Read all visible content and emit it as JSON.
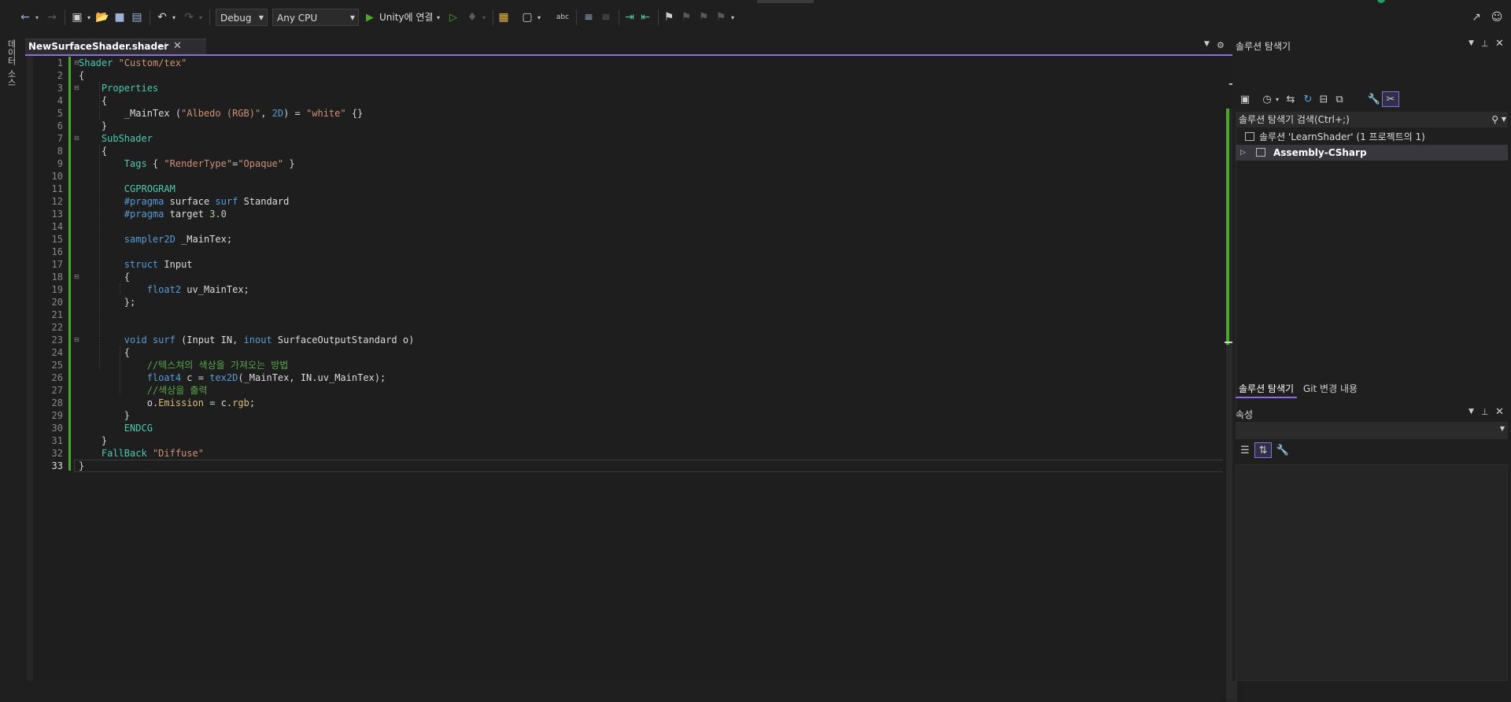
{
  "toolbar": {
    "configuration": "Debug",
    "platform": "Any CPU",
    "run_target": "Unity에 연결",
    "icons": [
      "back-arrow-icon",
      "forward-arrow-icon",
      "new-project-icon",
      "open-folder-icon",
      "save-icon",
      "save-all-icon",
      "undo-icon",
      "redo-icon",
      "start-green-icon",
      "start-without-debug-icon",
      "attach-icon",
      "solution-config-icon",
      "find-icon",
      "spellcheck-icon",
      "comment-icon",
      "uncomment-icon",
      "indent-icon",
      "outdent-icon",
      "bookmark-icon",
      "prev-bookmark-icon",
      "next-bookmark-icon",
      "clear-bookmark-icon",
      "share-icon",
      "feedback-icon"
    ]
  },
  "left_strip": {
    "labels": [
      "데이터",
      "소스"
    ]
  },
  "editor": {
    "tab_title": "NewSurfaceShader.shader",
    "line_numbers": [
      "1",
      "2",
      "3",
      "4",
      "5",
      "6",
      "7",
      "8",
      "9",
      "10",
      "11",
      "12",
      "13",
      "14",
      "15",
      "16",
      "17",
      "18",
      "19",
      "20",
      "21",
      "22",
      "23",
      "24",
      "25",
      "26",
      "27",
      "28",
      "29",
      "30",
      "31",
      "32",
      "33"
    ],
    "current_line": "33",
    "code_lines": [
      "Shader \"Custom/tex\"",
      "{",
      "    Properties",
      "    {",
      "        _MainTex (\"Albedo (RGB)\", 2D) = \"white\" {}",
      "    }",
      "    SubShader",
      "    {",
      "        Tags { \"RenderType\"=\"Opaque\" }",
      "",
      "        CGPROGRAM",
      "        #pragma surface surf Standard",
      "        #pragma target 3.0",
      "",
      "        sampler2D _MainTex;",
      "",
      "        struct Input",
      "        {",
      "            float2 uv_MainTex;",
      "        };",
      "",
      "",
      "        void surf (Input IN, inout SurfaceOutputStandard o)",
      "        {",
      "            //텍스쳐의 색상을 가져오는 방법",
      "            float4 c = tex2D(_MainTex, IN.uv_MainTex);",
      "            //색상을 출력",
      "            o.Emission = c.rgb;",
      "        }",
      "        ENDCG",
      "    }",
      "    FallBack \"Diffuse\"",
      "}"
    ]
  },
  "solution_explorer": {
    "title": "솔루션 탐색기",
    "search_placeholder": "솔루션 탐색기 검색(Ctrl+;)",
    "solution_label": "솔루션 'LearnShader' (1 프로젝트의 1)",
    "project_label": "Assembly-CSharp",
    "bottom_tabs": [
      "솔루션 탐색기",
      "Git 변경 내용"
    ]
  },
  "properties": {
    "title": "속성"
  },
  "colors": {
    "accent": "#8a6fe0",
    "change_bar": "#4ca72f",
    "keyword": "#569cd6",
    "shaderlab": "#4ec9b0",
    "string": "#ce9178",
    "comment": "#57a64a",
    "number": "#b5cea8"
  }
}
